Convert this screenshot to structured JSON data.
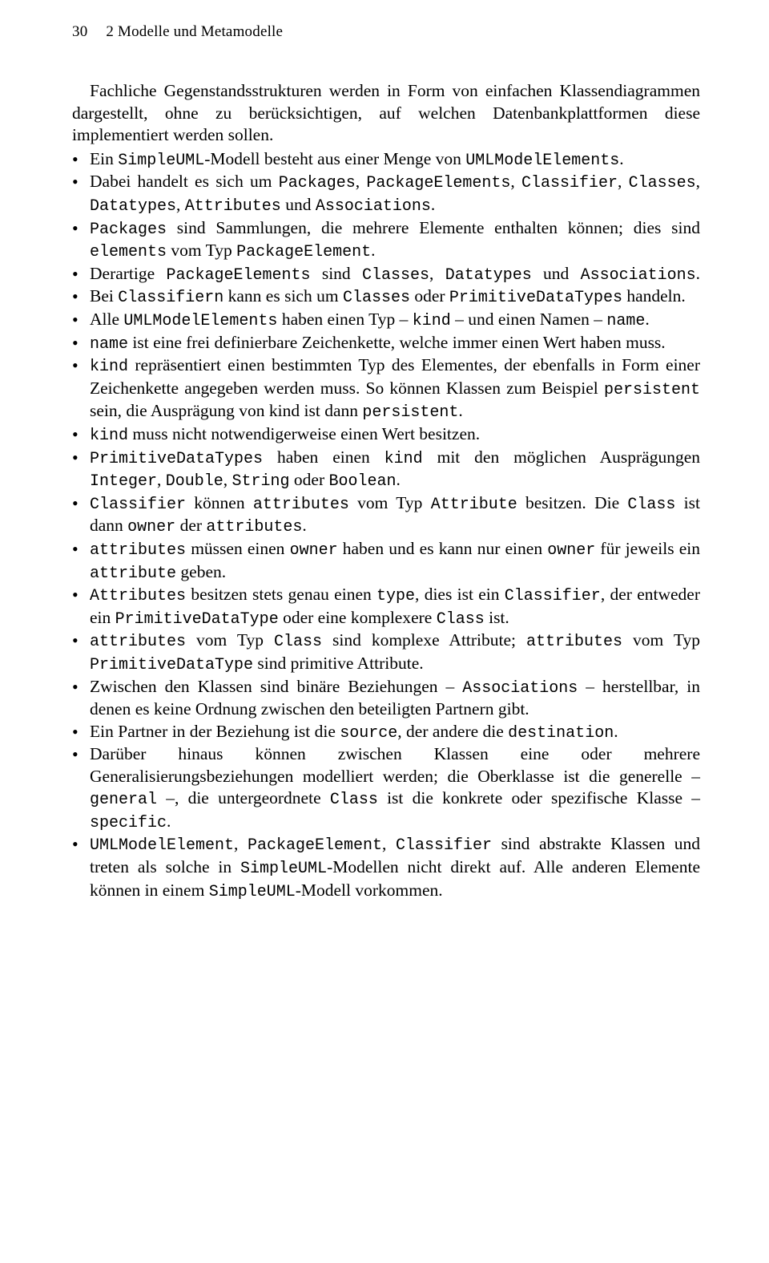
{
  "header": {
    "page_number": "30",
    "chapter": "2  Modelle und Metamodelle"
  },
  "intro": "Fachliche Gegenstandsstrukturen werden in Form von einfachen Klassendiagrammen dargestellt, ohne zu berücksichtigen, auf welchen Datenbankplattformen diese implementiert werden sollen.",
  "bullets": [
    {
      "segments": [
        {
          "t": "Ein "
        },
        {
          "t": "SimpleUML",
          "code": true
        },
        {
          "t": "-Modell besteht aus einer Menge von "
        },
        {
          "t": "UMLModelElements",
          "code": true
        },
        {
          "t": "."
        }
      ]
    },
    {
      "segments": [
        {
          "t": "Dabei handelt es sich um "
        },
        {
          "t": "Packages",
          "code": true
        },
        {
          "t": ", "
        },
        {
          "t": "PackageElements",
          "code": true
        },
        {
          "t": ", "
        },
        {
          "t": "Classifier",
          "code": true
        },
        {
          "t": ", "
        },
        {
          "t": "Classes",
          "code": true
        },
        {
          "t": ", "
        },
        {
          "t": "Datatypes",
          "code": true
        },
        {
          "t": ", "
        },
        {
          "t": "Attributes",
          "code": true
        },
        {
          "t": " und "
        },
        {
          "t": "Associations",
          "code": true
        },
        {
          "t": "."
        }
      ]
    },
    {
      "segments": [
        {
          "t": "Packages",
          "code": true
        },
        {
          "t": " sind Sammlungen, die mehrere Elemente enthalten können; dies sind "
        },
        {
          "t": "elements",
          "code": true
        },
        {
          "t": " vom Typ "
        },
        {
          "t": "PackageElement",
          "code": true
        },
        {
          "t": "."
        }
      ]
    },
    {
      "wide": true,
      "segments": [
        {
          "t": "Derartige "
        },
        {
          "t": "PackageElements",
          "code": true
        },
        {
          "t": " sind "
        },
        {
          "t": "Classes",
          "code": true
        },
        {
          "t": ", "
        },
        {
          "t": "Datatypes",
          "code": true
        },
        {
          "t": " und "
        },
        {
          "t": "Associations",
          "code": true
        },
        {
          "t": "."
        }
      ]
    },
    {
      "segments": [
        {
          "t": "Bei "
        },
        {
          "t": "Classifiern",
          "code": true
        },
        {
          "t": " kann es sich um "
        },
        {
          "t": "Classes",
          "code": true
        },
        {
          "t": " oder "
        },
        {
          "t": "PrimitiveDataTypes",
          "code": true
        },
        {
          "t": " handeln."
        }
      ]
    },
    {
      "segments": [
        {
          "t": "Alle "
        },
        {
          "t": "UMLModelElements",
          "code": true
        },
        {
          "t": " haben einen Typ – "
        },
        {
          "t": "kind",
          "code": true
        },
        {
          "t": " – und einen Namen – "
        },
        {
          "t": "name",
          "code": true
        },
        {
          "t": "."
        }
      ]
    },
    {
      "segments": [
        {
          "t": "name",
          "code": true
        },
        {
          "t": " ist eine frei definierbare Zeichenkette, welche immer einen Wert haben muss."
        }
      ]
    },
    {
      "segments": [
        {
          "t": "kind",
          "code": true
        },
        {
          "t": " repräsentiert einen bestimmten Typ des Elementes, der ebenfalls in Form einer Zeichenkette angegeben werden muss. So können Klassen zum Beispiel "
        },
        {
          "t": "persistent",
          "code": true
        },
        {
          "t": " sein, die Ausprägung von kind ist dann "
        },
        {
          "t": "persistent",
          "code": true
        },
        {
          "t": "."
        }
      ]
    },
    {
      "segments": [
        {
          "t": "kind",
          "code": true
        },
        {
          "t": " muss nicht notwendigerweise einen Wert besitzen."
        }
      ]
    },
    {
      "segments": [
        {
          "t": "PrimitiveDataTypes",
          "code": true
        },
        {
          "t": " haben einen "
        },
        {
          "t": "kind",
          "code": true
        },
        {
          "t": " mit den möglichen Ausprägungen "
        },
        {
          "t": "Integer",
          "code": true
        },
        {
          "t": ", "
        },
        {
          "t": "Double",
          "code": true
        },
        {
          "t": ", "
        },
        {
          "t": "String",
          "code": true
        },
        {
          "t": " oder "
        },
        {
          "t": "Boolean",
          "code": true
        },
        {
          "t": "."
        }
      ]
    },
    {
      "segments": [
        {
          "t": "Classifier",
          "code": true
        },
        {
          "t": " können "
        },
        {
          "t": "attributes",
          "code": true
        },
        {
          "t": " vom Typ "
        },
        {
          "t": "Attribute",
          "code": true
        },
        {
          "t": "  besitzen. Die "
        },
        {
          "t": "Class",
          "code": true
        },
        {
          "t": " ist dann "
        },
        {
          "t": "owner",
          "code": true
        },
        {
          "t": " der "
        },
        {
          "t": "attributes",
          "code": true
        },
        {
          "t": "."
        }
      ]
    },
    {
      "segments": [
        {
          "t": "attributes",
          "code": true
        },
        {
          "t": " müssen einen "
        },
        {
          "t": "owner",
          "code": true
        },
        {
          "t": " haben und es kann nur einen "
        },
        {
          "t": "owner",
          "code": true
        },
        {
          "t": " für jeweils ein "
        },
        {
          "t": "attribute",
          "code": true
        },
        {
          "t": " geben."
        }
      ]
    },
    {
      "segments": [
        {
          "t": "Attributes",
          "code": true
        },
        {
          "t": " besitzen stets genau einen "
        },
        {
          "t": "type",
          "code": true
        },
        {
          "t": ", dies ist ein "
        },
        {
          "t": "Classifier",
          "code": true
        },
        {
          "t": ", der entweder ein "
        },
        {
          "t": "PrimitiveDataType",
          "code": true
        },
        {
          "t": " oder eine komplexere "
        },
        {
          "t": "Class",
          "code": true
        },
        {
          "t": " ist."
        }
      ]
    },
    {
      "segments": [
        {
          "t": "attributes",
          "code": true
        },
        {
          "t": " vom Typ "
        },
        {
          "t": "Class",
          "code": true
        },
        {
          "t": " sind komplexe Attribute; "
        },
        {
          "t": "attributes",
          "code": true
        },
        {
          "t": " vom Typ "
        },
        {
          "t": "PrimitiveDataType",
          "code": true
        },
        {
          "t": "  sind primitive Attribute."
        }
      ]
    },
    {
      "segments": [
        {
          "t": "Zwischen den Klassen sind binäre Beziehungen – "
        },
        {
          "t": "Associations",
          "code": true
        },
        {
          "t": "  – herstellbar, in denen es keine Ordnung zwischen den beteiligten Partnern gibt."
        }
      ]
    },
    {
      "segments": [
        {
          "t": "Ein Partner in der Beziehung ist die "
        },
        {
          "t": "source",
          "code": true
        },
        {
          "t": ", der andere die "
        },
        {
          "t": "destination",
          "code": true
        },
        {
          "t": "."
        }
      ]
    },
    {
      "segments": [
        {
          "t": "Darüber hinaus können zwischen Klassen eine oder mehrere Generalisierungsbeziehungen modelliert werden; die Oberklasse ist die generelle – "
        },
        {
          "t": "general",
          "code": true
        },
        {
          "t": " –, die untergeordnete "
        },
        {
          "t": "Class",
          "code": true
        },
        {
          "t": " ist die konkrete oder spezifische Klasse – "
        },
        {
          "t": "specific",
          "code": true
        },
        {
          "t": "."
        }
      ]
    },
    {
      "segments": [
        {
          "t": "UMLModelElement",
          "code": true
        },
        {
          "t": ", "
        },
        {
          "t": "PackageElement",
          "code": true
        },
        {
          "t": ", "
        },
        {
          "t": "Classifier",
          "code": true
        },
        {
          "t": " sind abstrakte Klassen und treten als solche in "
        },
        {
          "t": "SimpleUML",
          "code": true
        },
        {
          "t": "-Modellen nicht direkt auf. Alle anderen Elemente können in einem "
        },
        {
          "t": "SimpleUML",
          "code": true
        },
        {
          "t": "-Modell vorkommen."
        }
      ]
    }
  ]
}
